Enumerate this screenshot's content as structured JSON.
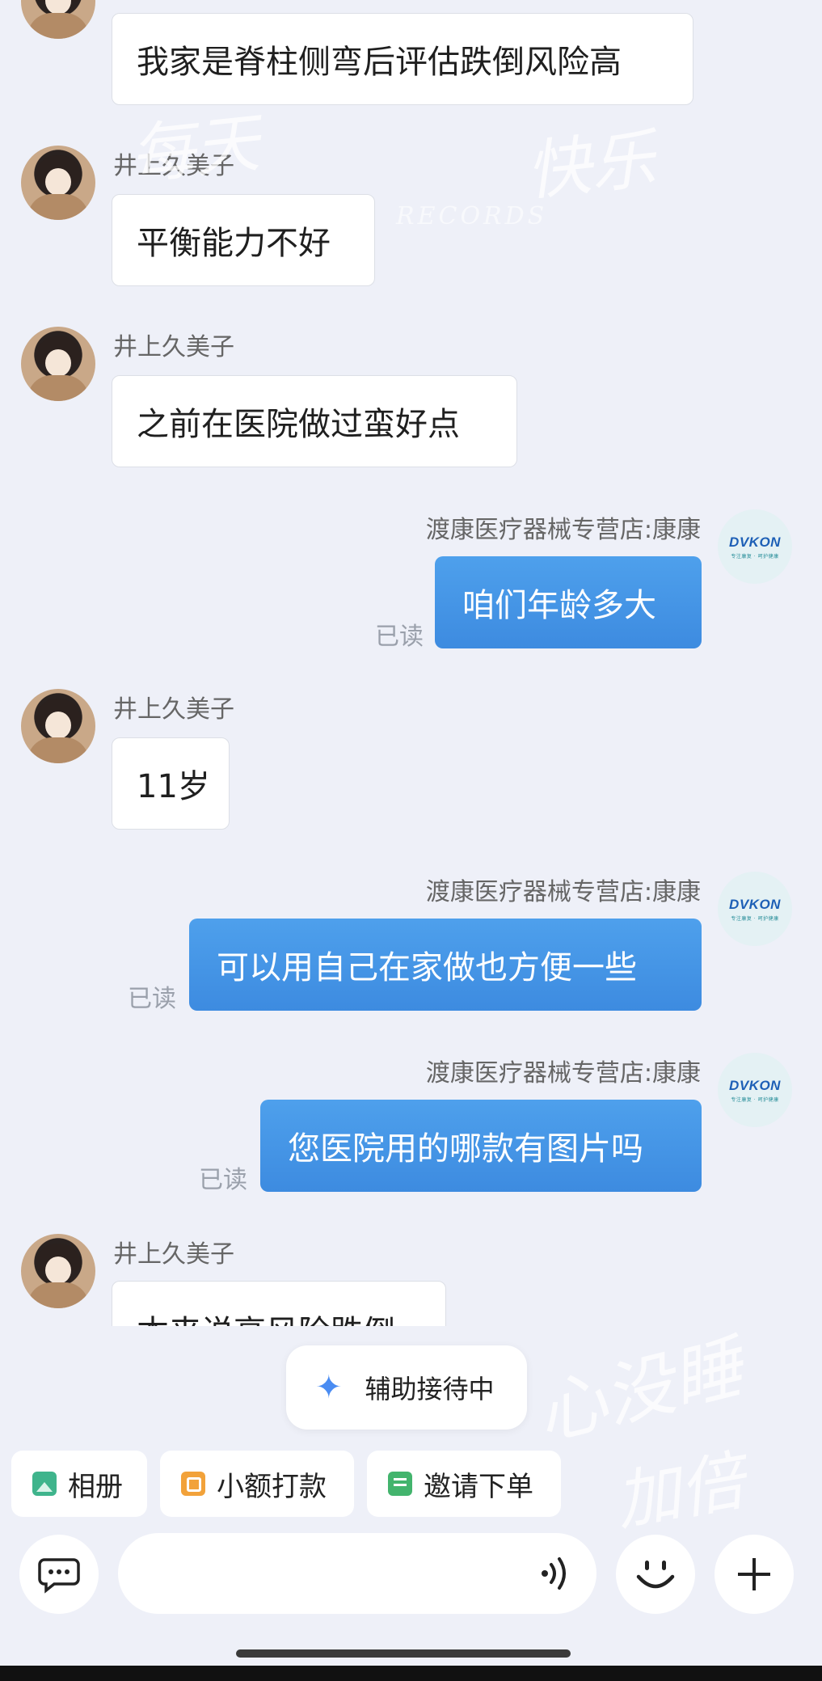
{
  "messages": [
    {
      "side": "in",
      "name": "",
      "text": "我家是脊柱侧弯后评估跌倒风险高"
    },
    {
      "side": "in",
      "name": "井上久美子",
      "text": "平衡能力不好"
    },
    {
      "side": "in",
      "name": "井上久美子",
      "text": "之前在医院做过蛮好点"
    },
    {
      "side": "out",
      "name": "渡康医疗器械专营店:康康",
      "text": "咱们年龄多大",
      "status": "已读"
    },
    {
      "side": "in",
      "name": "井上久美子",
      "text": "11岁"
    },
    {
      "side": "out",
      "name": "渡康医疗器械专营店:康康",
      "text": "可以用自己在家做也方便一些",
      "status": "已读"
    },
    {
      "side": "out",
      "name": "渡康医疗器械专营店:康康",
      "text": "您医院用的哪款有图片吗",
      "status": "已读"
    },
    {
      "side": "in",
      "name": "井上久美子",
      "text": "本来说高风险跌倒"
    }
  ],
  "shop_avatar": {
    "logo": "DVKON",
    "sub": "专注康复 · 呵护健康"
  },
  "assistant_button": {
    "label": "辅助接待中",
    "icon": "sparkle-icon"
  },
  "quick_actions": [
    {
      "label": "相册",
      "icon": "photo-icon"
    },
    {
      "label": "小额打款",
      "icon": "payment-icon"
    },
    {
      "label": "邀请下单",
      "icon": "invite-icon"
    }
  ],
  "input_bar": {
    "left_icon": "chat-bubble-icon",
    "voice_icon": "voice-icon",
    "emoji_icon": "emoji-icon",
    "plus_icon": "plus-icon"
  },
  "watermarks": [
    "每天",
    "快乐",
    "RECORDS",
    "心没睡",
    "加倍"
  ]
}
